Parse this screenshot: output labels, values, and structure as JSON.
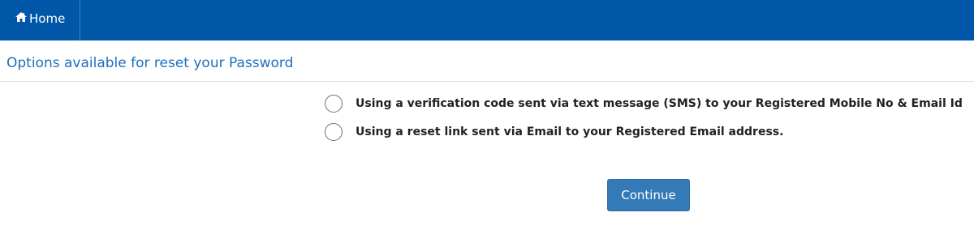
{
  "nav": {
    "home_label": "Home",
    "home_icon": "home-icon"
  },
  "page": {
    "title": "Options available for reset your Password"
  },
  "options": [
    {
      "label": "Using a verification code sent via text message (SMS) to your Registered Mobile No & Email Id",
      "selected": false
    },
    {
      "label": "Using a reset link sent via Email to your Registered Email address.",
      "selected": false
    }
  ],
  "actions": {
    "continue_label": "Continue"
  },
  "colors": {
    "nav_background": "#0057a8",
    "title_text": "#1a6fc0",
    "button_background": "#337ab7"
  }
}
